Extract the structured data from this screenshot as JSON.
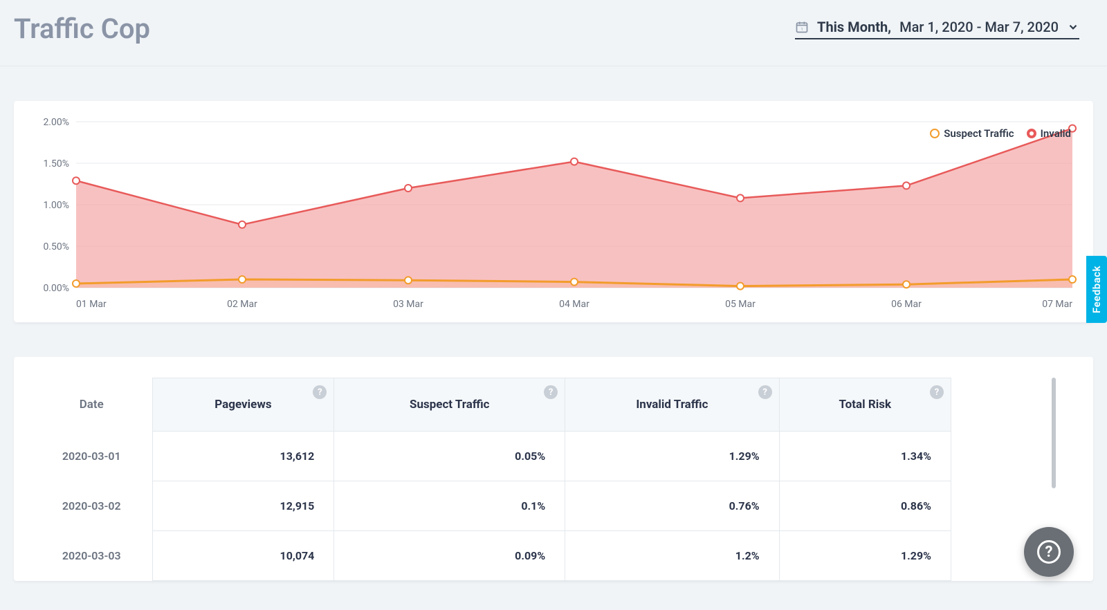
{
  "header": {
    "title": "Traffic Cop",
    "range_label": "This Month,",
    "range_value": "Mar 1, 2020 - Mar 7, 2020"
  },
  "legend": {
    "suspect": "Suspect Traffic",
    "invalid": "Invalid"
  },
  "chart_data": {
    "type": "area",
    "title": "",
    "xlabel": "",
    "ylabel": "",
    "ylim": [
      0,
      2.0
    ],
    "y_ticks": [
      "0.00%",
      "0.50%",
      "1.00%",
      "1.50%",
      "2.00%"
    ],
    "categories": [
      "01 Mar",
      "02 Mar",
      "03 Mar",
      "04 Mar",
      "05 Mar",
      "06 Mar",
      "07 Mar"
    ],
    "series": [
      {
        "name": "Suspect Traffic",
        "values": [
          0.05,
          0.1,
          0.09,
          0.07,
          0.02,
          0.04,
          0.1
        ]
      },
      {
        "name": "Invalid",
        "values": [
          1.29,
          0.76,
          1.2,
          1.52,
          1.08,
          1.23,
          1.92
        ]
      }
    ]
  },
  "table": {
    "headers": [
      "Date",
      "Pageviews",
      "Suspect Traffic",
      "Invalid Traffic",
      "Total Risk"
    ],
    "rows": [
      {
        "date": "2020-03-01",
        "pageviews": "13,612",
        "suspect": "0.05%",
        "invalid": "1.29%",
        "total": "1.34%"
      },
      {
        "date": "2020-03-02",
        "pageviews": "12,915",
        "suspect": "0.1%",
        "invalid": "0.76%",
        "total": "0.86%"
      },
      {
        "date": "2020-03-03",
        "pageviews": "10,074",
        "suspect": "0.09%",
        "invalid": "1.2%",
        "total": "1.29%"
      }
    ]
  },
  "feedback_label": "Feedback",
  "help_symbol": "?"
}
